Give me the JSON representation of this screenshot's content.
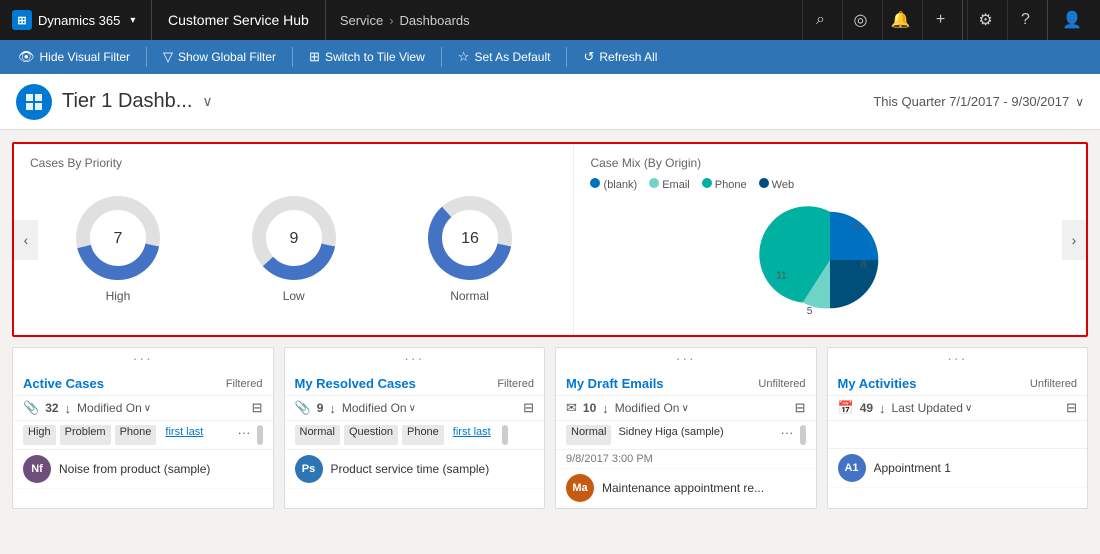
{
  "nav": {
    "d365_label": "Dynamics 365",
    "app_name": "Customer Service Hub",
    "breadcrumb_service": "Service",
    "breadcrumb_sep": ">",
    "breadcrumb_dashboards": "Dashboards",
    "icons": [
      "⌕",
      "◎",
      "♪",
      "+",
      "⚙",
      "?"
    ],
    "icon_names": [
      "search",
      "target",
      "bell",
      "add",
      "settings",
      "help"
    ]
  },
  "toolbar": {
    "hide_visual_filter": "Hide Visual Filter",
    "show_global_filter": "Show Global Filter",
    "switch_to_tile_view": "Switch to Tile View",
    "set_as_default": "Set As Default",
    "refresh_all": "Refresh All"
  },
  "page": {
    "title": "Tier 1 Dashb...",
    "quarter_label": "This Quarter 7/1/2017 - 9/30/2017"
  },
  "charts": {
    "cases_by_priority": {
      "title": "Cases By Priority",
      "items": [
        {
          "label": "High",
          "value": 7,
          "blue_pct": 43
        },
        {
          "label": "Low",
          "value": 9,
          "blue_pct": 35
        },
        {
          "label": "Normal",
          "value": 16,
          "blue_pct": 60
        }
      ]
    },
    "case_mix": {
      "title": "Case Mix (By Origin)",
      "legend": [
        {
          "label": "(blank)",
          "color": "#0070c0"
        },
        {
          "label": "Email",
          "color": "#70d3c8"
        },
        {
          "label": "Phone",
          "color": "#00b0a0"
        },
        {
          "label": "Web",
          "color": "#004e7a"
        }
      ],
      "segments": [
        {
          "label": "8",
          "value": 8,
          "color": "#0070c0",
          "start": 0,
          "sweep": 90
        },
        {
          "label": "8",
          "value": 8,
          "color": "#004e7a",
          "start": 90,
          "sweep": 90
        },
        {
          "label": "5",
          "value": 5,
          "color": "#70d3c8",
          "start": 180,
          "sweep": 56
        },
        {
          "label": "11",
          "value": 11,
          "color": "#00b0a0",
          "start": 236,
          "sweep": 124
        }
      ]
    }
  },
  "tiles": [
    {
      "id": "active-cases",
      "title": "Active Cases",
      "filter": "Filtered",
      "icon": "📎",
      "count": "32",
      "sort": "Modified On",
      "tags": [
        "High",
        "Problem",
        "Phone",
        "first last",
        "..."
      ],
      "tag_types": [
        "normal",
        "normal",
        "normal",
        "link",
        "dots"
      ],
      "row": {
        "avatar_initials": "Nf",
        "avatar_color": "#6f4e7c",
        "text": "Noise from product (sample)"
      }
    },
    {
      "id": "my-resolved-cases",
      "title": "My Resolved Cases",
      "filter": "Filtered",
      "icon": "📎",
      "count": "9",
      "sort": "Modified On",
      "tags": [
        "Normal",
        "Question",
        "Phone",
        "first last"
      ],
      "tag_types": [
        "normal",
        "normal",
        "normal",
        "link"
      ],
      "row": {
        "avatar_initials": "Ps",
        "avatar_color": "#2e75b6",
        "text": "Product service time (sample)"
      }
    },
    {
      "id": "my-draft-emails",
      "title": "My Draft Emails",
      "filter": "Unfiltered",
      "icon": "✉",
      "count": "10",
      "sort": "Modified On",
      "row_meta": "Normal  Sidney Higa (sample)",
      "row_date": "9/8/2017 3:00 PM",
      "row2": {
        "avatar_initials": "Ma",
        "avatar_color": "#c55a11",
        "text": "Maintenance appointment re..."
      }
    },
    {
      "id": "my-activities",
      "title": "My Activities",
      "filter": "Unfiltered",
      "icon": "📅",
      "count": "49",
      "sort": "Last Updated",
      "row": {
        "avatar_initials": "A1",
        "avatar_color": "#4472c4",
        "text": "Appointment 1"
      }
    }
  ]
}
